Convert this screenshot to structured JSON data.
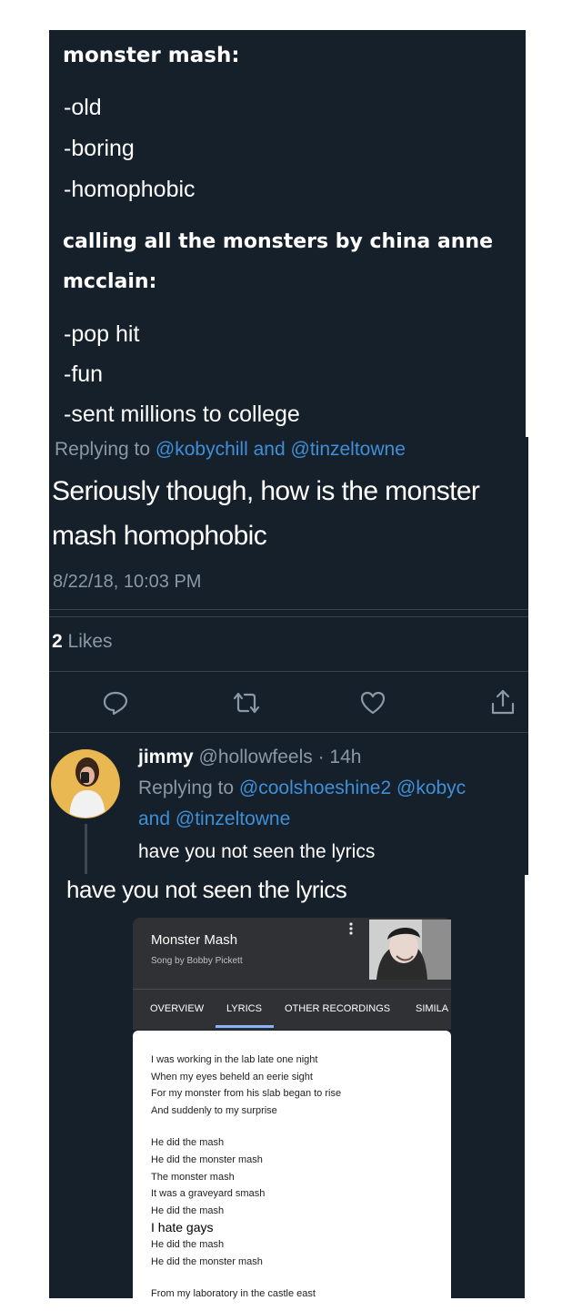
{
  "post1": {
    "heading1": "monster mash:",
    "items1": [
      "-old",
      "-boring",
      "-homophobic"
    ],
    "heading2_line1": "calling all the monsters by china anne",
    "heading2_line2": "mcclain:",
    "items2": [
      "-pop hit",
      "-fun",
      "-sent millions to college"
    ]
  },
  "reply1": {
    "replying_prefix": "Replying to",
    "mention1": "@kobychill",
    "and": "and",
    "mention2": "@tinzeltowne",
    "text_line1": "Seriously though, how is the monster",
    "text_line2": "mash homophobic",
    "timestamp": "8/22/18, 10:03 PM",
    "likes_count": "2",
    "likes_label": "Likes"
  },
  "actions": {
    "reply_icon": "speech-bubble-icon",
    "retweet_icon": "retweet-icon",
    "like_icon": "heart-icon",
    "share_icon": "share-icon"
  },
  "reply2": {
    "name": "jimmy",
    "handle": "@hollowfeels",
    "time": "· 14h",
    "replying_prefix": "Replying to",
    "mentions_line1": "@coolshoeshine2 @kobyc",
    "and": "and",
    "mention3": "@tinzeltowne",
    "text": "have you not seen the lyrics"
  },
  "caption": "have you not seen the lyrics",
  "google_card": {
    "title": "Monster Mash",
    "subtitle": "Song by Bobby Pickett",
    "more_icon": "more-vertical-icon",
    "tabs": [
      "OVERVIEW",
      "LYRICS",
      "OTHER RECORDINGS",
      "SIMILA"
    ],
    "active_tab": "LYRICS",
    "verse1": [
      "I was working in the lab late one night",
      "When my eyes beheld an eerie sight",
      "For my monster from his slab began to rise",
      "And suddenly to my surprise"
    ],
    "verse2": [
      "He did the mash",
      "He did the monster mash",
      "The monster mash",
      "It was a graveyard smash",
      "He did the mash"
    ],
    "inserted_line": "I hate gays",
    "verse2_end": [
      "He did the mash",
      "He did the monster mash"
    ],
    "verse3": [
      "From my laboratory in the castle east"
    ]
  },
  "colors": {
    "background": "#16202b",
    "link": "#3f8fd8",
    "secondary": "#8b98a5"
  }
}
